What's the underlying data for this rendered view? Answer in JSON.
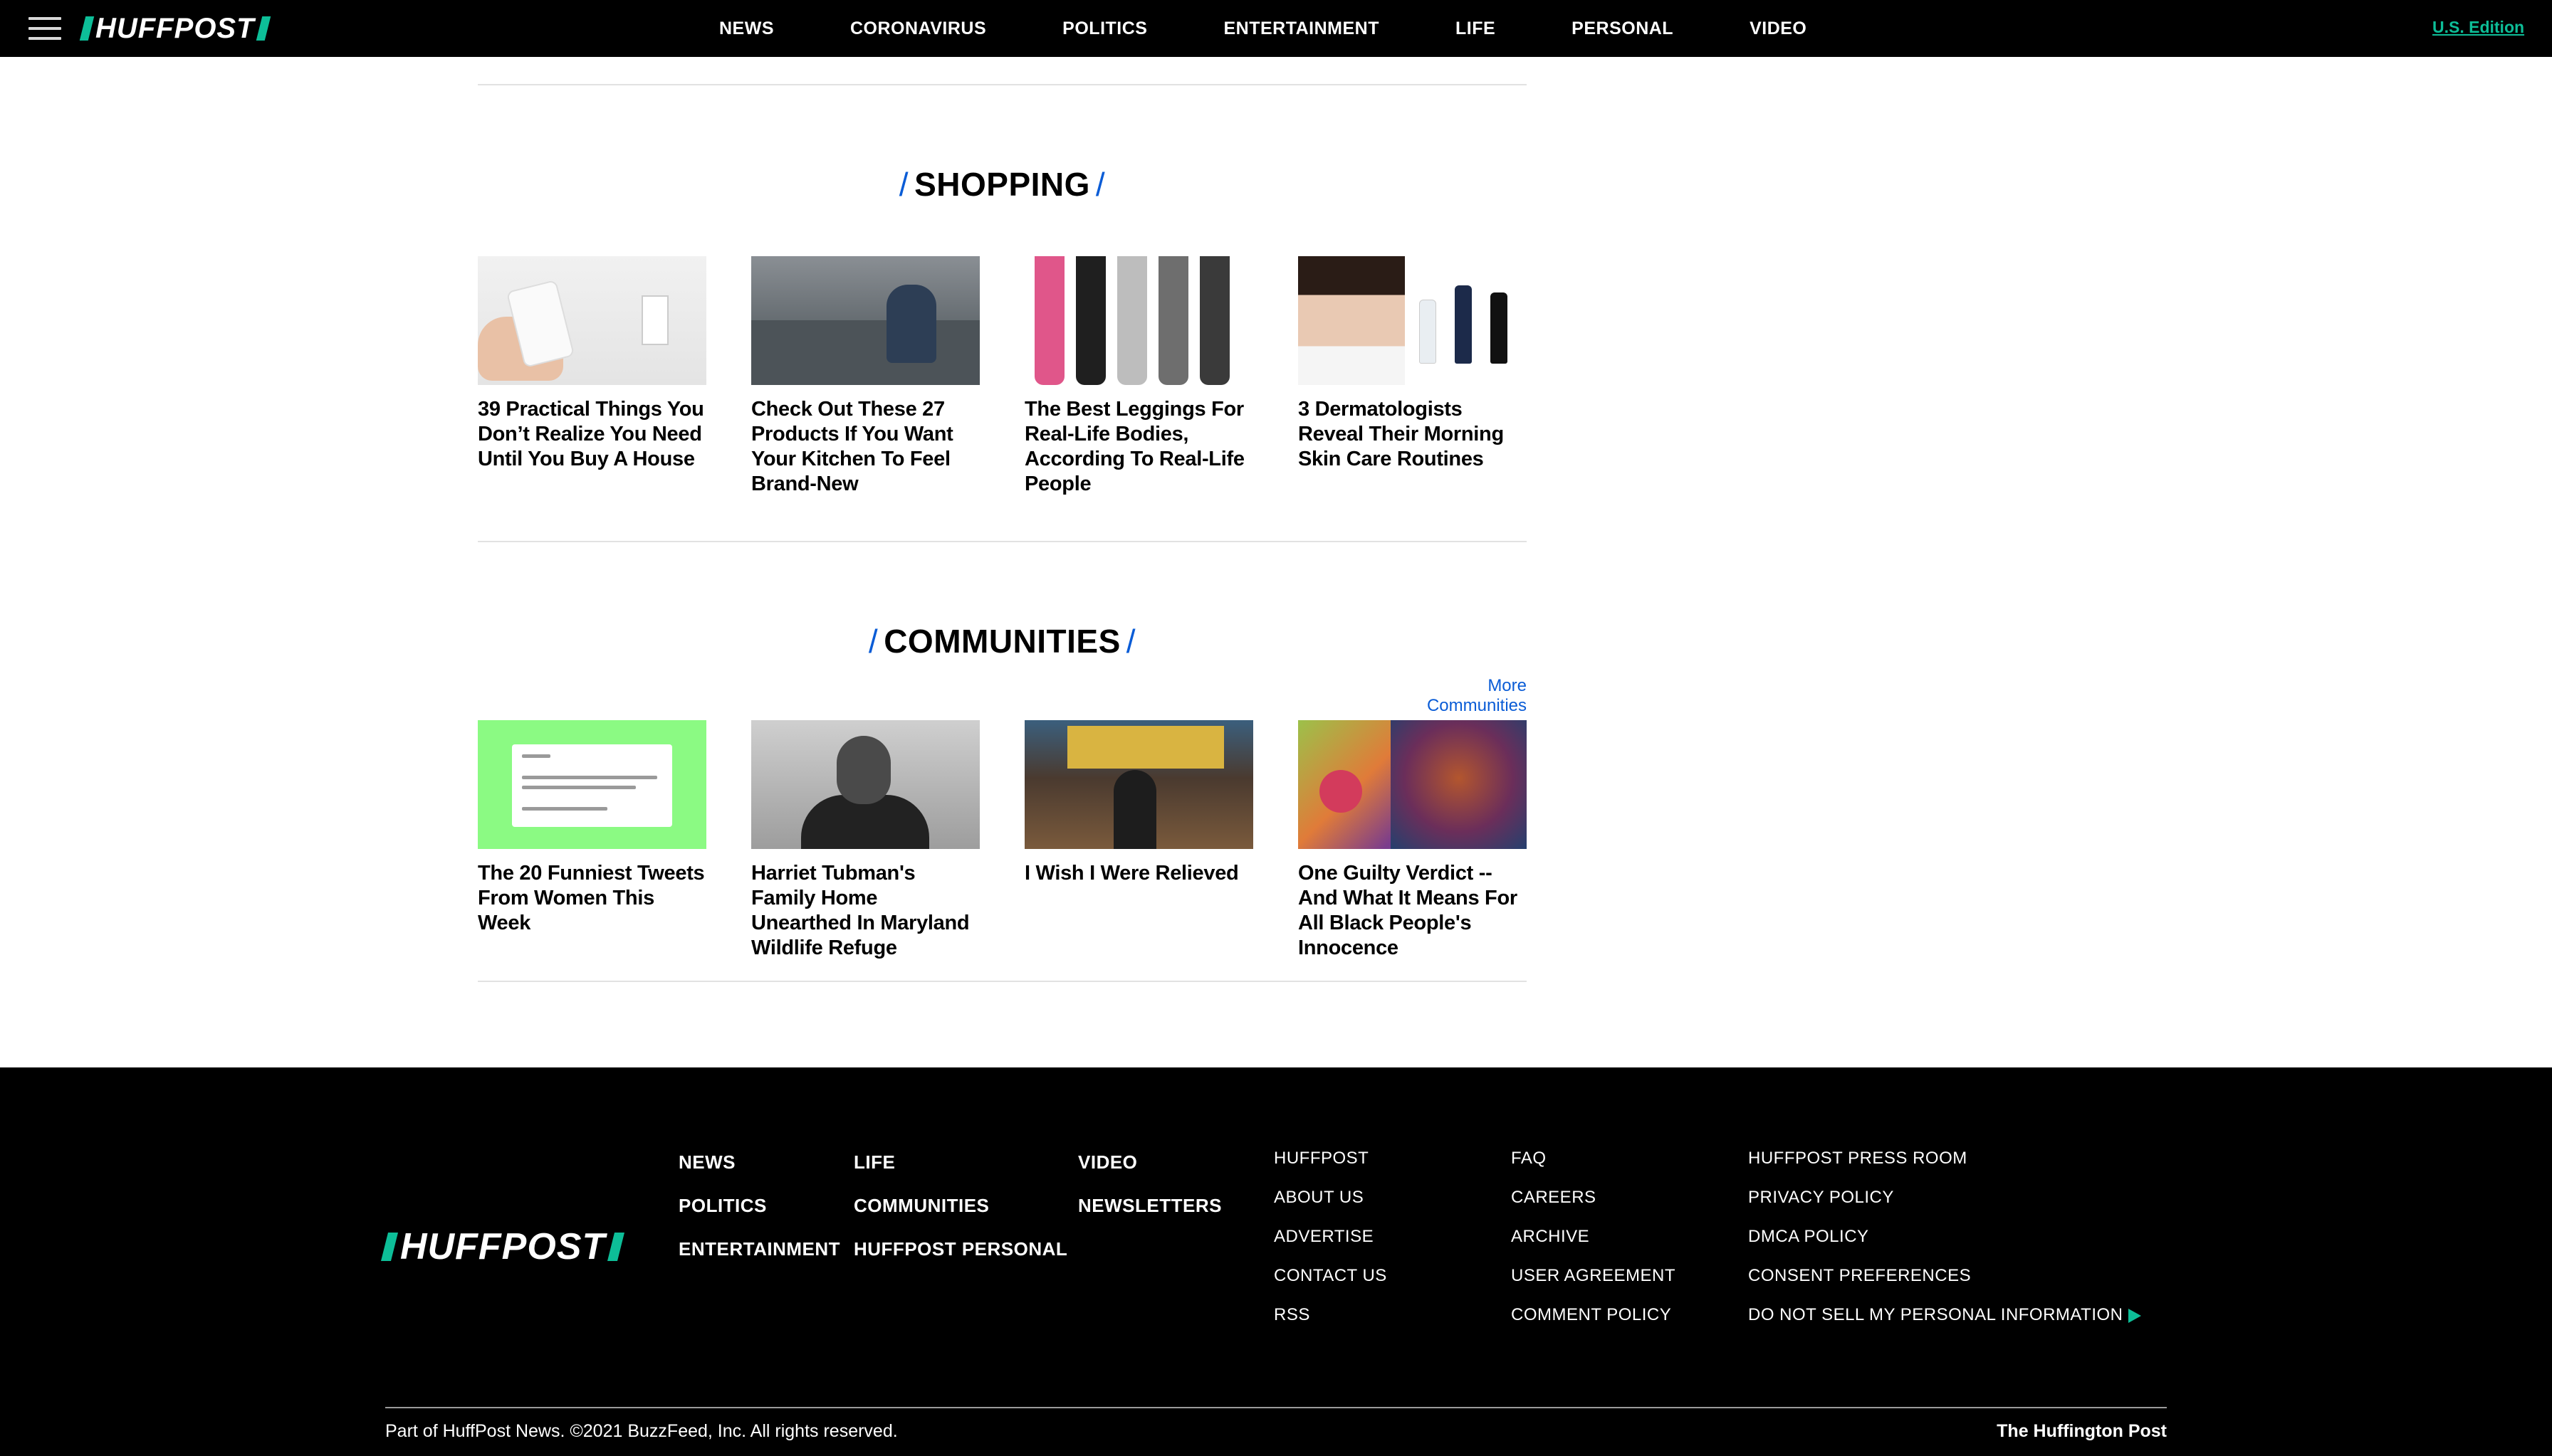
{
  "nav": {
    "logo": "HUFFPOST",
    "links": [
      "NEWS",
      "CORONAVIRUS",
      "POLITICS",
      "ENTERTAINMENT",
      "LIFE",
      "PERSONAL",
      "VIDEO"
    ],
    "edition": "U.S. Edition"
  },
  "shopping": {
    "title": "SHOPPING",
    "cards": [
      {
        "title": "39 Practical Things You Don’t Realize You Need Until You Buy A House"
      },
      {
        "title": "Check Out These 27 Products If You Want Your Kitchen To Feel Brand-New"
      },
      {
        "title": "The Best Leggings For Real-Life Bodies, According To Real-Life People"
      },
      {
        "title": "3 Dermatologists Reveal Their Morning Skin Care Routines"
      }
    ]
  },
  "communities": {
    "title": "COMMUNITIES",
    "more_link": "More Communities",
    "cards": [
      {
        "title": "The 20 Funniest Tweets From Women This Week"
      },
      {
        "title": "Harriet Tubman's Family Home Unearthed In Maryland Wildlife Refuge"
      },
      {
        "title": "I Wish I Were Relieved"
      },
      {
        "title": "One Guilty Verdict -- And What It Means For All Black People's Innocence"
      }
    ]
  },
  "footer": {
    "logo": "HUFFPOST",
    "sections_col1": [
      "NEWS",
      "POLITICS",
      "ENTERTAINMENT"
    ],
    "sections_col2": [
      "LIFE",
      "COMMUNITIES",
      "HUFFPOST PERSONAL"
    ],
    "sections_col3": [
      "VIDEO",
      "NEWSLETTERS"
    ],
    "links_col1": [
      "HUFFPOST",
      "ABOUT US",
      "ADVERTISE",
      "CONTACT US",
      "RSS"
    ],
    "links_col2": [
      "FAQ",
      "CAREERS",
      "ARCHIVE",
      "USER AGREEMENT",
      "COMMENT POLICY"
    ],
    "links_col3": [
      "HUFFPOST PRESS ROOM",
      "PRIVACY POLICY",
      "DMCA POLICY",
      "CONSENT PREFERENCES",
      "DO NOT SELL MY PERSONAL INFORMATION"
    ],
    "copyright": "Part of HuffPost News. ©2021 BuzzFeed, Inc. All rights reserved.",
    "brand": "The Huffington Post"
  },
  "colors": {
    "brand_green": "#0dbe98",
    "accent_blue": "#0a5cd6",
    "nav_bg": "#000000"
  },
  "icons": [
    "hamburger-menu-icon",
    "play-triangle-icon"
  ]
}
